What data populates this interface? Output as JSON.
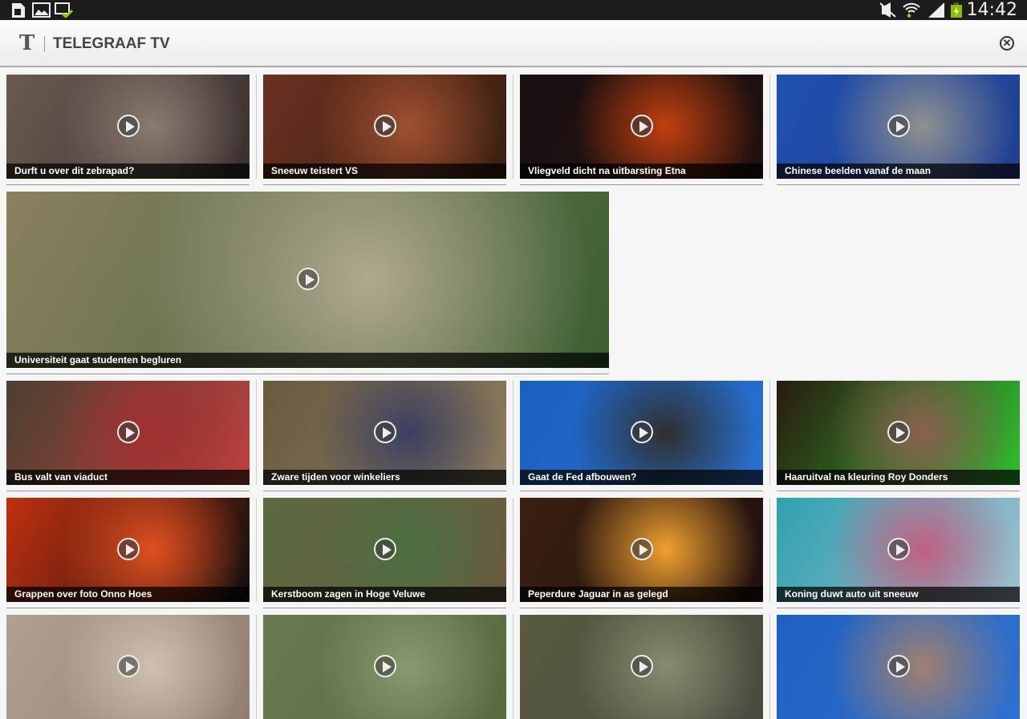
{
  "status_bar": {
    "time": "14:42",
    "icons": [
      "sim-icon",
      "gallery-icon",
      "download-done-icon",
      "mute-icon",
      "wifi-icon",
      "signal-icon",
      "battery-charging-icon"
    ]
  },
  "header": {
    "logo": "T",
    "title": "TELEGRAAF TV",
    "close_icon": "close-circle-icon"
  },
  "videos": [
    {
      "title": "Durft u over dit zebrapad?",
      "colors": [
        "#6a5a50",
        "#8a7a70",
        "#3a3030"
      ]
    },
    {
      "title": "Sneeuw teistert VS",
      "colors": [
        "#6a3020",
        "#a05030",
        "#3a2010"
      ]
    },
    {
      "title": "Vliegveld dicht na uitbarsting Etna",
      "colors": [
        "#1a1010",
        "#c04010",
        "#201010"
      ]
    },
    {
      "title": "Chinese beelden vanaf de maan",
      "colors": [
        "#2050b0",
        "#909090",
        "#204090"
      ]
    },
    {
      "title": "Universiteit gaat studenten begluren",
      "colors": [
        "#8a8060",
        "#b0a890",
        "#3a6030"
      ]
    },
    {
      "title": "Bus valt van viaduct",
      "colors": [
        "#4a4030",
        "#a03030",
        "#c04040"
      ]
    },
    {
      "title": "Zware tijden voor winkeliers",
      "colors": [
        "#6a5a40",
        "#3a4060",
        "#8a7a60"
      ]
    },
    {
      "title": "Gaat de Fed afbouwen?",
      "colors": [
        "#1a60c0",
        "#303030",
        "#2a70d0"
      ]
    },
    {
      "title": "Haaruitval na kleuring Roy Donders",
      "colors": [
        "#2a1a10",
        "#8a6050",
        "#30c030"
      ]
    },
    {
      "title": "Grappen over foto Onno Hoes",
      "colors": [
        "#c03010",
        "#e05020",
        "#101010"
      ]
    },
    {
      "title": "Kerstboom zagen in Hoge Veluwe",
      "colors": [
        "#5a6a40",
        "#4a7040",
        "#6a5a40"
      ]
    },
    {
      "title": "Peperdure Jaguar in as gelegd",
      "colors": [
        "#3a2010",
        "#f0a030",
        "#201010"
      ]
    },
    {
      "title": "Koning duwt auto uit sneeuw",
      "colors": [
        "#30a0b0",
        "#c06080",
        "#a0c0d0"
      ]
    },
    {
      "title": "",
      "colors": [
        "#b0a090",
        "#d0c0b0",
        "#908070"
      ]
    },
    {
      "title": "",
      "colors": [
        "#6a7a50",
        "#8a9a70",
        "#5a6a40"
      ]
    },
    {
      "title": "",
      "colors": [
        "#5a5a40",
        "#8a8a70",
        "#4a4a40"
      ]
    },
    {
      "title": "",
      "colors": [
        "#2060c0",
        "#a08070",
        "#3070d0"
      ]
    }
  ]
}
